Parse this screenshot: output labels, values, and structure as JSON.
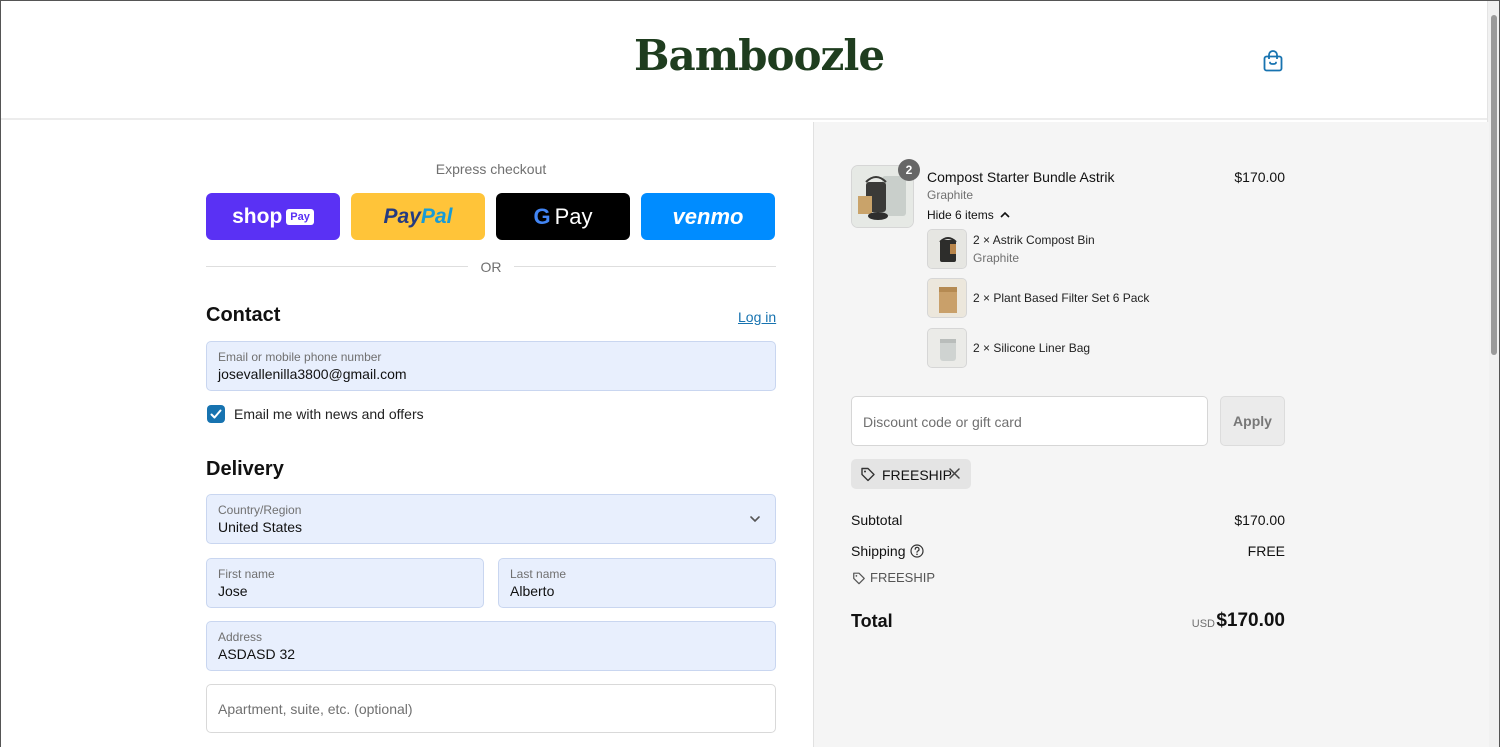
{
  "header": {
    "logo": "Bamboozle",
    "cart_icon": "shopping-bag-icon"
  },
  "express": {
    "title": "Express checkout",
    "shop_pay": {
      "label": "shop",
      "tag": "Pay"
    },
    "paypal": {
      "pay": "Pay",
      "pal": "Pal"
    },
    "gpay": {
      "g": "G",
      "label": "Pay"
    },
    "venmo": {
      "label": "venmo"
    },
    "or": "OR"
  },
  "contact": {
    "title": "Contact",
    "login": "Log in",
    "email": {
      "label": "Email or mobile phone number",
      "value": "josevallenilla3800@gmail.com"
    },
    "newsletter": {
      "label": "Email me with news and offers",
      "checked": true
    }
  },
  "delivery": {
    "title": "Delivery",
    "country": {
      "label": "Country/Region",
      "value": "United States"
    },
    "first_name": {
      "label": "First name",
      "value": "Jose"
    },
    "last_name": {
      "label": "Last name",
      "value": "Alberto"
    },
    "address": {
      "label": "Address",
      "value": "ASDASD 32"
    },
    "apartment": {
      "placeholder": "Apartment, suite, etc. (optional)"
    }
  },
  "summary": {
    "item": {
      "name": "Compost Starter Bundle Astrik",
      "variant": "Graphite",
      "price": "$170.00",
      "qty": "2",
      "toggle": "Hide 6 items"
    },
    "sub_items": [
      {
        "name": "2 × Astrik Compost Bin",
        "variant": "Graphite"
      },
      {
        "name": "2 × Plant Based Filter Set 6 Pack",
        "variant": ""
      },
      {
        "name": "2 × Silicone Liner Bag",
        "variant": ""
      }
    ],
    "discount": {
      "placeholder": "Discount code or gift card",
      "apply": "Apply",
      "applied_code": "FREESHIP"
    },
    "subtotal": {
      "label": "Subtotal",
      "value": "$170.00"
    },
    "shipping": {
      "label": "Shipping",
      "value": "FREE",
      "code": "FREESHIP"
    },
    "total": {
      "label": "Total",
      "currency": "USD",
      "value": "$170.00"
    }
  }
}
